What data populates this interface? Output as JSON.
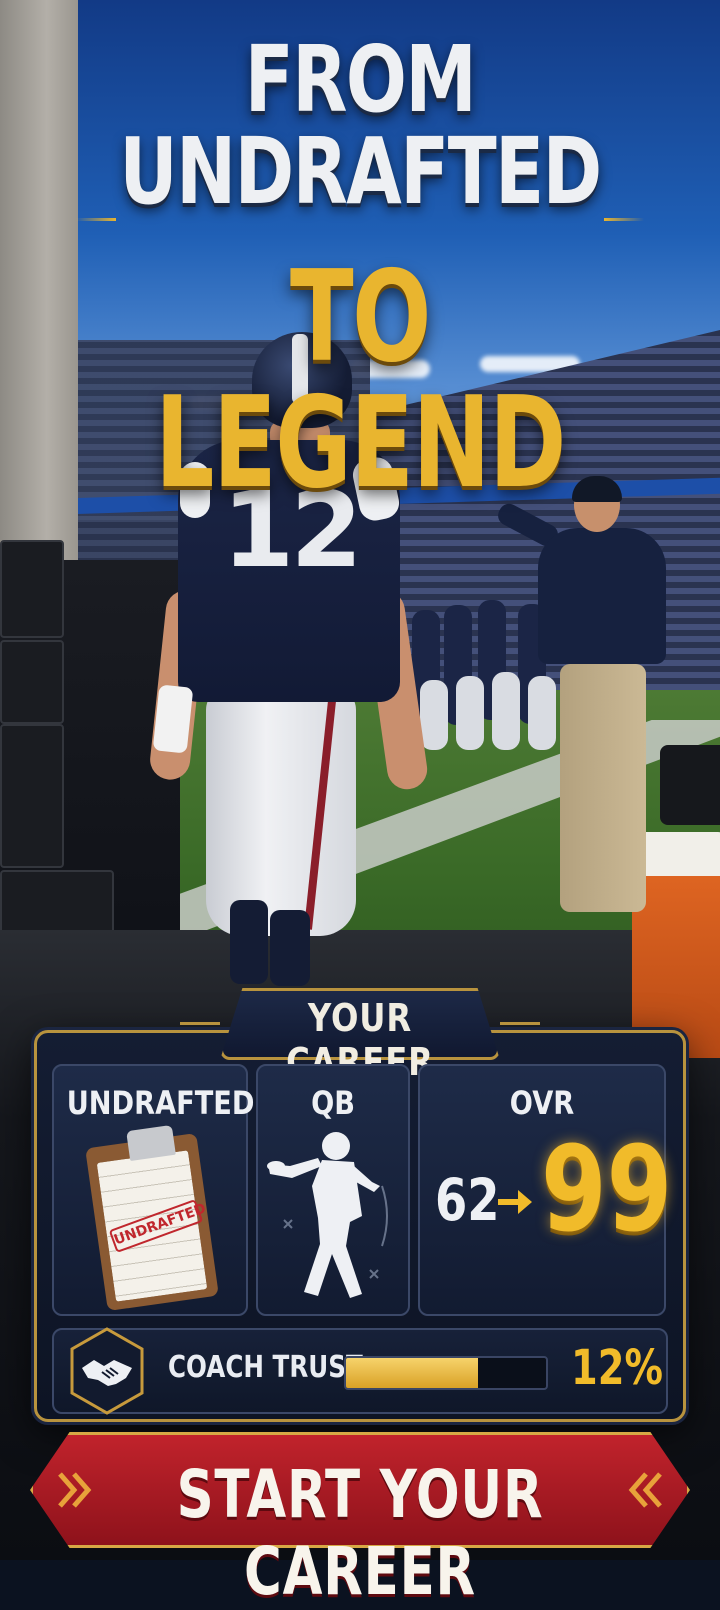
{
  "headline": {
    "line1": "FROM UNDRAFTED",
    "line2": "TO LEGEND"
  },
  "scene": {
    "jersey_number": "12"
  },
  "career_panel": {
    "title": "YOUR CAREER",
    "cards": [
      {
        "label": "UNDRAFTED",
        "stamp_text": "UNDRAFTED",
        "icon": "clipboard-icon"
      },
      {
        "label": "QB",
        "icon": "quarterback-silhouette-icon"
      },
      {
        "label": "OVR",
        "from": "62",
        "to": "99",
        "icon": "arrow-right-icon"
      }
    ],
    "coach_trust": {
      "label": "COACH TRUST",
      "value_text": "12%",
      "icon": "handshake-icon"
    }
  },
  "cta": {
    "label": "START YOUR CAREER",
    "icon": "chevron-icon"
  },
  "colors": {
    "gold": "#e9b52f",
    "cta_red": "#c1232c",
    "panel_navy": "#141d33"
  }
}
